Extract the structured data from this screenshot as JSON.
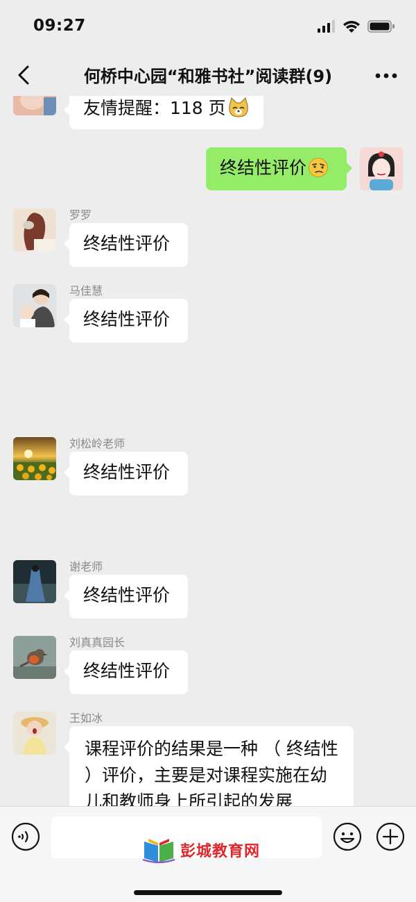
{
  "status_bar": {
    "time": "09:27"
  },
  "nav": {
    "title": "何桥中心园“和雅书社”阅读群(9)"
  },
  "messages": [
    {
      "sender": "",
      "text": "友情提醒：118 页",
      "emoji": "cat-face-emoji",
      "direction": "in"
    },
    {
      "sender": "",
      "text": "终结性评价",
      "emoji": "thinking-face-emoji",
      "direction": "out"
    },
    {
      "sender": "罗罗",
      "text": "终结性评价",
      "direction": "in"
    },
    {
      "sender": "马佳慧",
      "text": "终结性评价",
      "direction": "in"
    },
    {
      "sender": "刘松岭老师",
      "text": "终结性评价",
      "direction": "in"
    },
    {
      "sender": "谢老师",
      "text": "终结性评价",
      "direction": "in"
    },
    {
      "sender": "刘真真园长",
      "text": "终结性评价",
      "direction": "in"
    },
    {
      "sender": "王如冰",
      "text": "课程评价的结果是一种 （  终结性  ）评价，主要是对课程实施在幼儿和教师身上所引起的发展",
      "direction": "in"
    }
  ],
  "input_bar": {
    "voice_icon": "voice-icon",
    "emoji_icon": "emoji-icon",
    "plus_icon": "plus-icon"
  },
  "watermark": {
    "text": "彭城教育网"
  },
  "colors": {
    "background": "#ededed",
    "outgoing_bubble": "#95ec69",
    "incoming_bubble": "#ffffff",
    "watermark": "#e0262b"
  }
}
